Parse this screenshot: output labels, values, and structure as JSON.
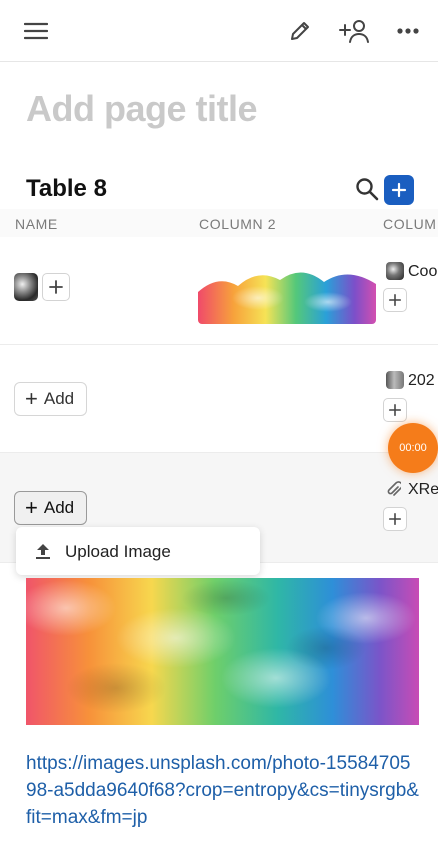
{
  "page": {
    "title_placeholder": "Add page title"
  },
  "table": {
    "title": "Table 8",
    "columns": [
      "NAME",
      "COLUMN 2",
      "COLUM"
    ]
  },
  "rows": [
    {
      "col3_text": "Coo"
    },
    {
      "add_label": "Add",
      "col3_text": "202"
    },
    {
      "add_label": "Add",
      "col3_text": "XRe"
    }
  ],
  "upload_menu": {
    "item_label": "Upload Image"
  },
  "timer": {
    "label": "00:00",
    "color": "#f57c1a"
  },
  "image_link": {
    "url": "https://images.unsplash.com/photo-1558470598-a5dda9640f68?crop=entropy&cs=tinysrgb&fit=max&fm=jp"
  },
  "colors": {
    "accent": "#1a5ec0",
    "link": "#1e5fa8"
  },
  "icons": [
    "menu-icon",
    "edit-icon",
    "add-user-icon",
    "more-icon",
    "search-icon",
    "plus-icon",
    "upload-icon",
    "paperclip-icon"
  ]
}
